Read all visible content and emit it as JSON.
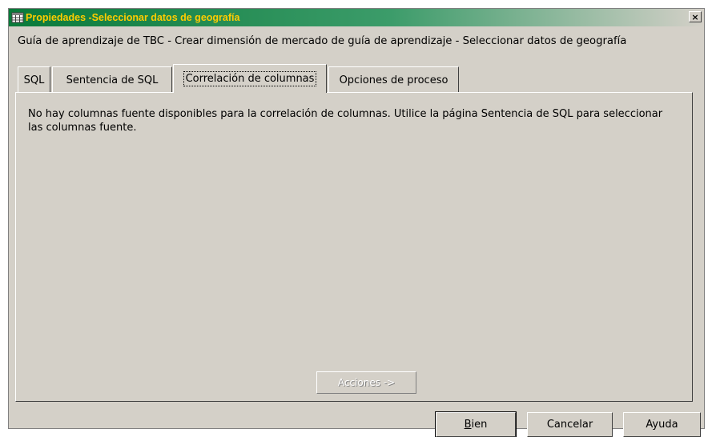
{
  "window": {
    "title": "Propiedades -Seleccionar datos de geografía",
    "close_symbol": "×"
  },
  "breadcrumb": "Guía de aprendizaje de TBC - Crear dimensión de mercado de guía de aprendizaje - Seleccionar datos de geografía",
  "tabs": [
    {
      "label": "SQL"
    },
    {
      "label": "Sentencia de SQL"
    },
    {
      "label": "Correlación de columnas",
      "active": true
    },
    {
      "label": "Opciones de proceso"
    }
  ],
  "panel": {
    "message": "No hay columnas fuente disponibles para la correlación de columnas. Utilice la página Sentencia de SQL para seleccionar las columnas fuente.",
    "actions_label": "Acciones ->"
  },
  "buttons": {
    "ok_first": "B",
    "ok_rest": "ien",
    "cancel": "Cancelar",
    "help": "Ayuda"
  },
  "icons": {
    "app": "table-icon",
    "close": "close-icon"
  }
}
